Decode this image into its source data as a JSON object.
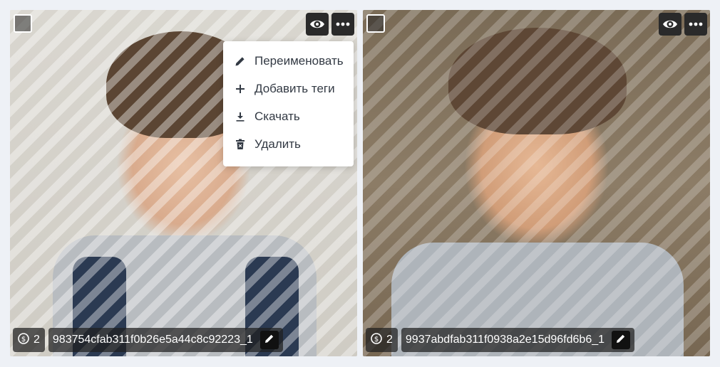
{
  "cards": [
    {
      "name": "983754cfab311f0b26e5a44c8c92223_1",
      "credits": "2",
      "icons": {
        "preview": "eye-icon",
        "more": "more-dots-icon",
        "credits": "coin-icon",
        "edit": "pencil-icon"
      }
    },
    {
      "name": "9937abdfab311f0938a2e15d96fd6b6_1",
      "credits": "2",
      "icons": {
        "preview": "eye-icon",
        "more": "more-dots-icon",
        "credits": "coin-icon",
        "edit": "pencil-icon"
      }
    }
  ],
  "menu": {
    "items": [
      {
        "label": "Переименовать",
        "icon": "pencil-icon"
      },
      {
        "label": "Добавить теги",
        "icon": "plus-icon"
      },
      {
        "label": "Скачать",
        "icon": "download-icon"
      },
      {
        "label": "Удалить",
        "icon": "trash-icon"
      }
    ]
  },
  "colors": {
    "page_background": "#eef1f6",
    "button_dark": "#2a2a2a",
    "menu_text": "#333a44"
  }
}
